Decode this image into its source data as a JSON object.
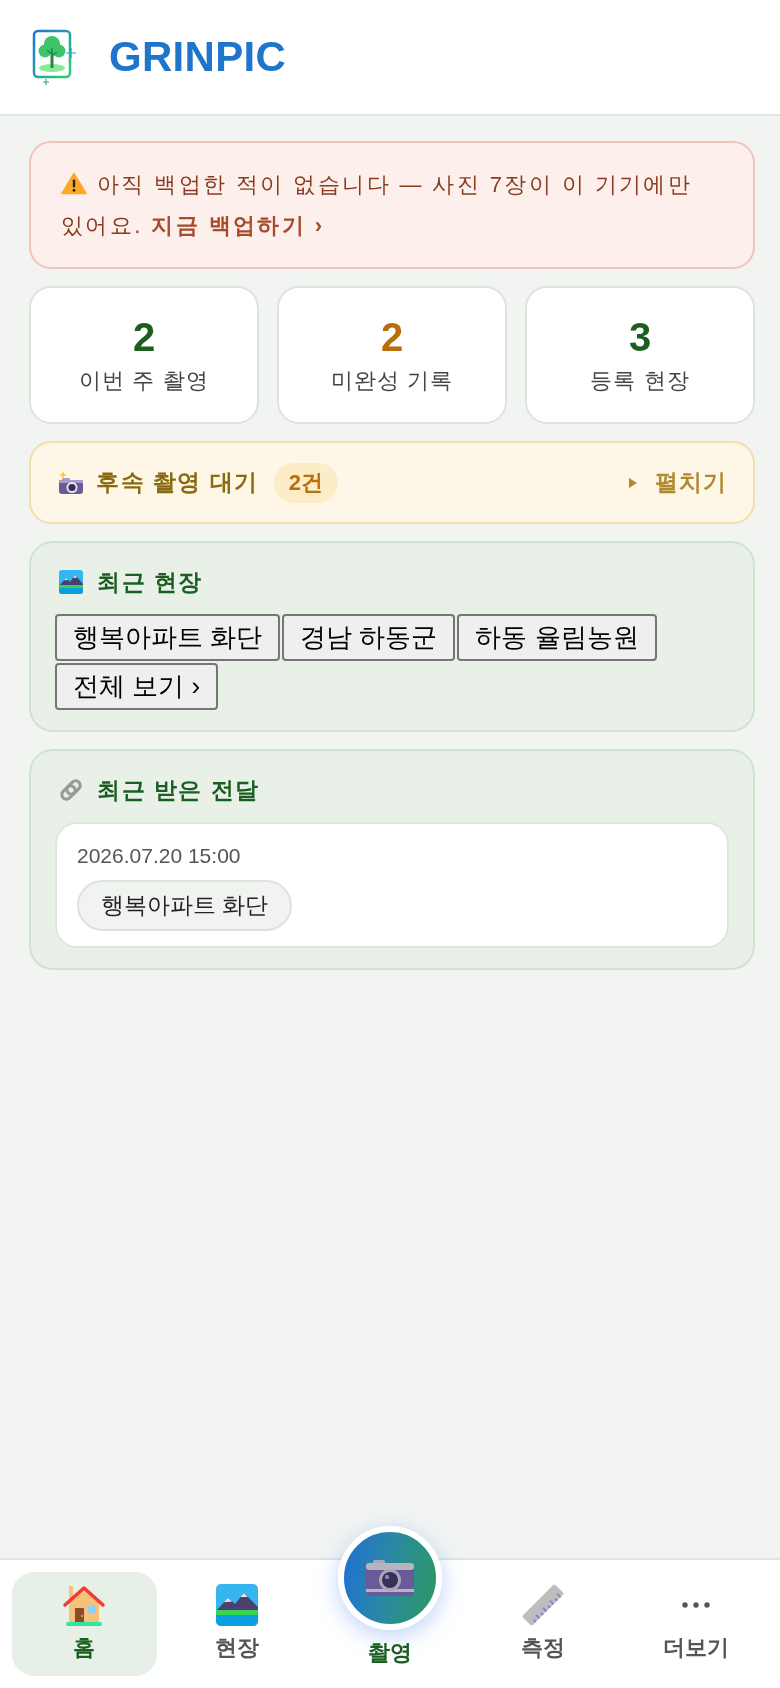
{
  "header": {
    "title": "GRINPIC"
  },
  "backup_warning": {
    "message": "아직 백업한 적이 없습니다 — 사진 7장이 이 기기에만 있어요.",
    "link": "지금 백업하기 ›"
  },
  "stats": [
    {
      "value": "2",
      "label": "이번 주 촬영",
      "color": "#1b5e20"
    },
    {
      "value": "2",
      "label": "미완성 기록",
      "color": "#b86e0a"
    },
    {
      "value": "3",
      "label": "등록 현장",
      "color": "#1b5e20"
    }
  ],
  "follow_up": {
    "title": "후속 촬영 대기",
    "count": "2건",
    "toggle": "펼치기",
    "expanded": false
  },
  "recent_sites": {
    "title": "최근 현장",
    "sites": [
      "행복아파트 화단",
      "경남 하동군",
      "하동 율림농원"
    ],
    "view_all": "전체 보기 ›"
  },
  "received": {
    "title": "최근 받은 전달",
    "items": [
      {
        "date": "2026.07.20 15:00",
        "site": "행복아파트 화단"
      }
    ]
  },
  "nav": {
    "items": [
      {
        "label": "홈",
        "kind": "tab",
        "selected": true
      },
      {
        "label": "현장",
        "kind": "tab",
        "selected": false
      },
      {
        "label": "촬영",
        "kind": "primary",
        "selected": false
      },
      {
        "label": "측정",
        "kind": "tab",
        "selected": false
      },
      {
        "label": "더보기",
        "kind": "tab",
        "selected": false
      }
    ]
  }
}
